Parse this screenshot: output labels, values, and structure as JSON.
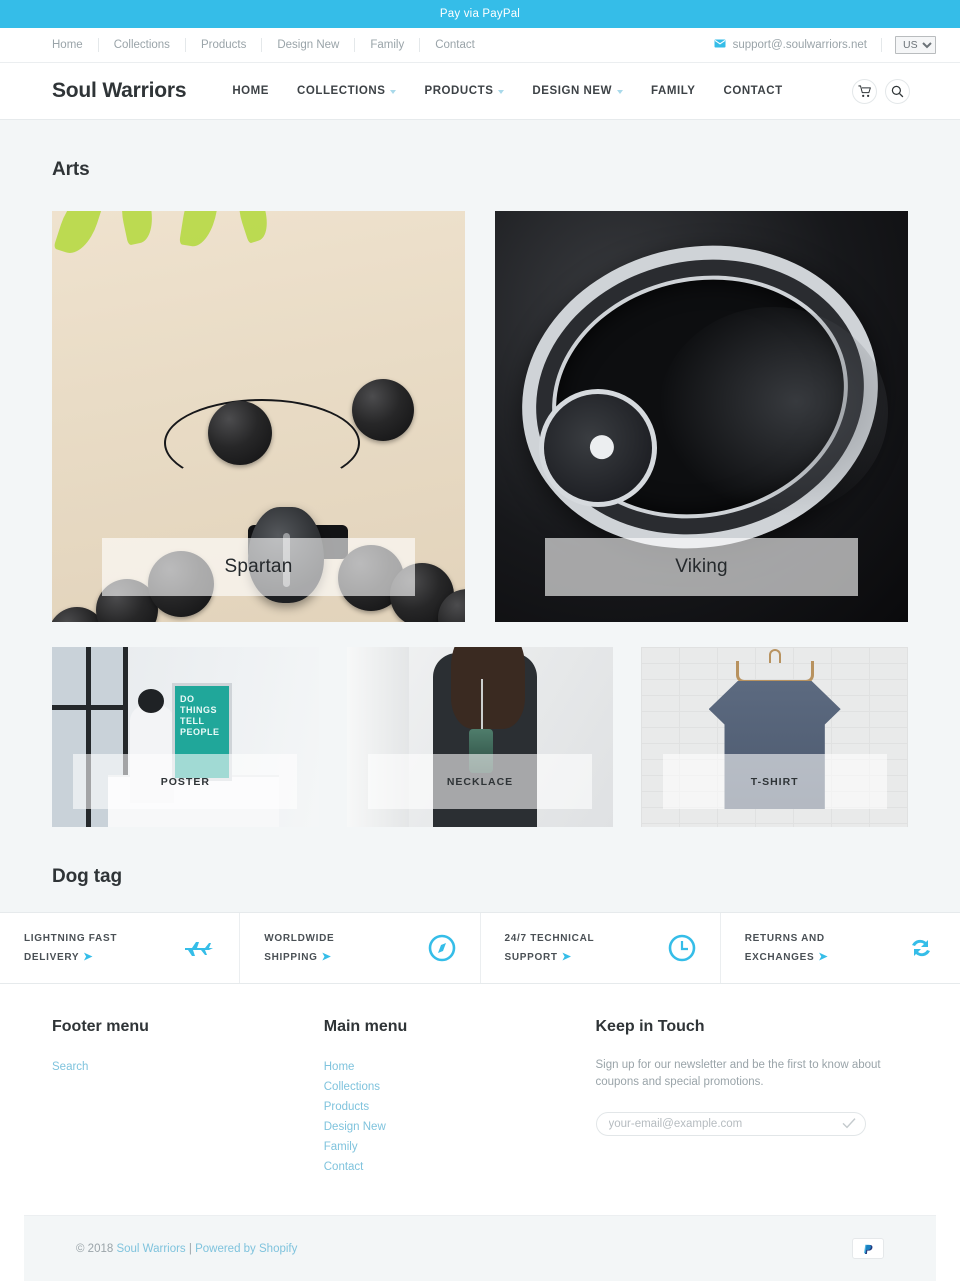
{
  "promo": {
    "text": "Pay via PayPal",
    "bg": "#35bde8"
  },
  "utility": {
    "links": [
      {
        "label": "Home"
      },
      {
        "label": "Collections"
      },
      {
        "label": "Products"
      },
      {
        "label": "Design New"
      },
      {
        "label": "Family"
      },
      {
        "label": "Contact"
      }
    ],
    "email": "support@.soulwarriors.net",
    "mail_icon": "envelope-icon",
    "currency": {
      "selected": "USD",
      "options": [
        "USD"
      ]
    }
  },
  "header": {
    "brand": "Soul Warriors",
    "nav": [
      {
        "label": "HOME",
        "has_dropdown": false
      },
      {
        "label": "COLLECTIONS",
        "has_dropdown": true
      },
      {
        "label": "PRODUCTS",
        "has_dropdown": true
      },
      {
        "label": "DESIGN NEW",
        "has_dropdown": true
      },
      {
        "label": "FAMILY",
        "has_dropdown": false
      },
      {
        "label": "CONTACT",
        "has_dropdown": false
      }
    ],
    "cart_icon": "shopping-cart-icon",
    "search_icon": "search-icon"
  },
  "main": {
    "arts_title": "Arts",
    "dogtag_title": "Dog tag",
    "collections_large": [
      {
        "label": "Spartan",
        "art": "black-lava-bead-bracelet-with-spartan-helmet-charm"
      },
      {
        "label": "Viking",
        "art": "engraved-silver-ring-on-black-background"
      }
    ],
    "collections_small": [
      {
        "label": "POSTER",
        "art": "framed-poster-in-bright-room"
      },
      {
        "label": "NECKLACE",
        "art": "woman-wearing-long-pendant-necklace"
      },
      {
        "label": "T-SHIRT",
        "art": "blue-tshirt-on-wooden-hanger-brick-wall"
      }
    ]
  },
  "features": [
    {
      "line1": "LIGHTNING FAST",
      "line2": "DELIVERY",
      "icon": "airplane-icon"
    },
    {
      "line1": "WORLDWIDE",
      "line2": "SHIPPING",
      "icon": "compass-icon"
    },
    {
      "line1": "24/7 TECHNICAL",
      "line2": "SUPPORT",
      "icon": "clock-icon"
    },
    {
      "line1": "RETURNS AND",
      "line2": "EXCHANGES",
      "icon": "refresh-icon"
    }
  ],
  "footer": {
    "col1": {
      "title": "Footer menu",
      "links": [
        {
          "label": "Search"
        }
      ]
    },
    "col2": {
      "title": "Main menu",
      "links": [
        {
          "label": "Home"
        },
        {
          "label": "Collections"
        },
        {
          "label": "Products"
        },
        {
          "label": "Design New"
        },
        {
          "label": "Family"
        },
        {
          "label": "Contact"
        }
      ]
    },
    "col3": {
      "title": "Keep in Touch",
      "body": "Sign up for our newsletter and be the first to know about coupons and special promotions.",
      "placeholder": "your-email@example.com",
      "submit_icon": "check-icon"
    }
  },
  "bottom": {
    "copyright_prefix": "© 2018 ",
    "brand_link": "Soul Warriors",
    "separator": " | ",
    "powered_link": "Powered by Shopify",
    "payment_icon": "paypal-icon"
  },
  "colors": {
    "accent": "#35bde8",
    "link": "#7fc3dd",
    "text": "#3d4246",
    "page_bg": "#f3f6f7"
  }
}
